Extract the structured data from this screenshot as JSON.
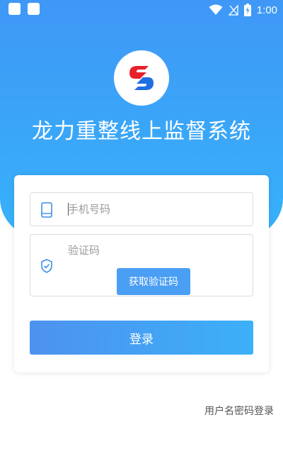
{
  "status_bar": {
    "time": "1:00",
    "icons": [
      "app-notification-icon",
      "app-notification-icon",
      "wifi-icon",
      "no-signal-icon",
      "battery-charging-icon"
    ]
  },
  "app": {
    "title": "龙力重整线上监督系统",
    "logo": "app-logo"
  },
  "form": {
    "phone_placeholder": "手机号码",
    "phone_value": "",
    "code_placeholder": "验证码",
    "code_value": "",
    "get_code_label": "获取验证码",
    "login_label": "登录"
  },
  "alt_login_label": "用户名密码登录",
  "colors": {
    "primary": "#3f98f6",
    "accent_light": "#37b2fa",
    "logo_red": "#e8202a",
    "logo_blue": "#1f6fe0"
  }
}
